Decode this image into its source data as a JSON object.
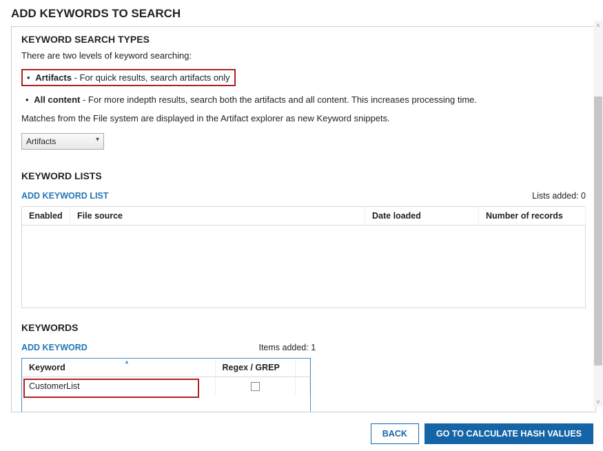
{
  "page_title": "ADD KEYWORDS TO SEARCH",
  "search_types": {
    "heading": "KEYWORD SEARCH TYPES",
    "intro": "There are two levels of keyword searching:",
    "artifacts_label": "Artifacts",
    "artifacts_desc": " - For quick results, search artifacts only",
    "allcontent_label": "All content",
    "allcontent_desc": " - For more indepth results, search both the artifacts and all content. This increases processing time.",
    "matches_note": "Matches from the File system are displayed in the Artifact explorer as new Keyword snippets.",
    "dropdown_value": "Artifacts"
  },
  "keyword_lists": {
    "heading": "KEYWORD LISTS",
    "add_label": "ADD KEYWORD LIST",
    "count_label": "Lists added: 0",
    "columns": {
      "enabled": "Enabled",
      "file_source": "File source",
      "date_loaded": "Date loaded",
      "num_records": "Number of records"
    }
  },
  "keywords": {
    "heading": "KEYWORDS",
    "add_label": "ADD KEYWORD",
    "count_label": "Items added: 1",
    "columns": {
      "keyword": "Keyword",
      "regex": "Regex / GREP"
    },
    "rows": [
      {
        "keyword": "CustomerList",
        "regex_checked": false
      }
    ]
  },
  "buttons": {
    "back": "BACK",
    "next": "GO TO CALCULATE HASH VALUES"
  }
}
